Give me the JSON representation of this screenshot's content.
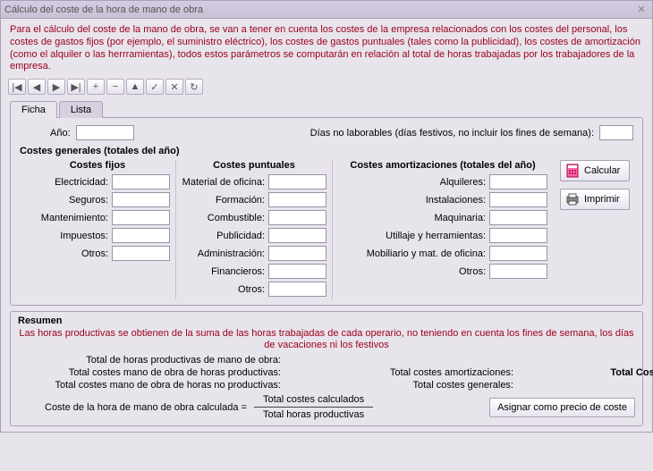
{
  "window": {
    "title": "Cálculo del coste de la hora de mano de obra"
  },
  "intro": "Para el cálculo del coste de la mano de obra, se van a tener en cuenta los costes de la empresa relacionados con los costes del personal, los costes de gastos fijos (por ejemplo, el suministro eléctrico), los costes de gastos puntuales (tales como la publicidad), los costes de amortización (como el alquiler o las herrramientas), todos estos parámetros se computarán en relación al total de horas trabajadas por los trabajadores de la empresa.",
  "toolbar": {
    "first": "|◀",
    "prev": "◀",
    "next": "▶",
    "last": "▶|",
    "add": "+",
    "del": "−",
    "up": "▲",
    "ok": "✓",
    "cancel": "✕",
    "reload": "↻"
  },
  "tabs": {
    "ficha": "Ficha",
    "lista": "Lista"
  },
  "top": {
    "anio_label": "Año:",
    "anio": "",
    "dias_label": "Días no laborables (días festivos, no incluir los fines de semana):",
    "dias": ""
  },
  "sections": {
    "generales": "Costes generales (totales del año)",
    "fijos": "Costes fijos",
    "puntuales": "Costes puntuales",
    "amort": "Costes amortizaciones (totales del año)"
  },
  "fijos": {
    "electricidad": {
      "label": "Electricidad:",
      "value": ""
    },
    "seguros": {
      "label": "Seguros:",
      "value": ""
    },
    "mantenimiento": {
      "label": "Mantenimiento:",
      "value": ""
    },
    "impuestos": {
      "label": "Impuestos:",
      "value": ""
    },
    "otros": {
      "label": "Otros:",
      "value": ""
    }
  },
  "puntuales": {
    "material": {
      "label": "Material de oficina:",
      "value": ""
    },
    "formacion": {
      "label": "Formación:",
      "value": ""
    },
    "combustible": {
      "label": "Combustible:",
      "value": ""
    },
    "publicidad": {
      "label": "Publicidad:",
      "value": ""
    },
    "administracion": {
      "label": "Administración:",
      "value": ""
    },
    "financieros": {
      "label": "Financieros:",
      "value": ""
    },
    "otros": {
      "label": "Otros:",
      "value": ""
    }
  },
  "amort": {
    "alquileres": {
      "label": "Alquileres:",
      "value": ""
    },
    "instalaciones": {
      "label": "Instalaciones:",
      "value": ""
    },
    "maquinaria": {
      "label": "Maquinaria:",
      "value": ""
    },
    "utillaje": {
      "label": "Utillaje y herramientas:",
      "value": ""
    },
    "mobiliario": {
      "label": "Mobiliario y mat. de oficina:",
      "value": ""
    },
    "otros": {
      "label": "Otros:",
      "value": ""
    }
  },
  "actions": {
    "calcular": "Calcular",
    "imprimir": "Imprimir"
  },
  "resumen": {
    "title": "Resumen",
    "note": "Las horas productivas se obtienen de la suma de las horas trabajadas de cada operario, no teniendo en cuenta los fines de semana, los días de vacaciones ni los festivos",
    "r1": "Total de horas productivas de mano de obra:",
    "r2": "Total costes mano de obra de horas productivas:",
    "r3": "Total costes mano de obra de horas no productivas:",
    "r4": "Total costes amortizaciones:",
    "r5": "Total costes generales:",
    "total_costes": "Total Costes",
    "formula_label": "Coste de la hora de mano de obra calculada  =",
    "frac_top": "Total costes calculados",
    "frac_bot": "Total horas productivas",
    "assign": "Asignar como precio de coste"
  }
}
